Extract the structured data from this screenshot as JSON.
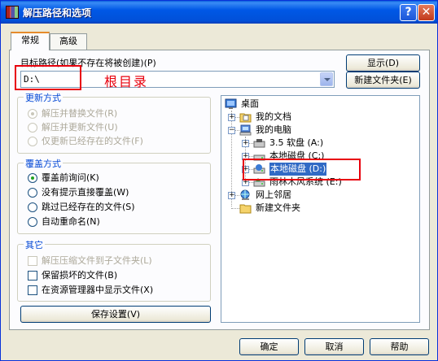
{
  "window": {
    "title": "解压路径和选项",
    "help_btn": "?",
    "close_btn": "✕"
  },
  "tabs": [
    {
      "label": "常规"
    },
    {
      "label": "高级"
    }
  ],
  "target": {
    "label": "目标路径(如果不存在将被创建)(P)",
    "value": "D:\\",
    "show_btn": "显示(D)",
    "new_folder_btn": "新建文件夹(E)"
  },
  "annotation": {
    "text": "根目录",
    "color": "#e8000c"
  },
  "update_mode": {
    "legend": "更新方式",
    "options": [
      {
        "label": "解压并替换文件(R)",
        "selected": true,
        "enabled": false
      },
      {
        "label": "解压并更新文件(U)",
        "selected": false,
        "enabled": false
      },
      {
        "label": "仅更新已经存在的文件(F)",
        "selected": false,
        "enabled": false
      }
    ]
  },
  "overwrite_mode": {
    "legend": "覆盖方式",
    "options": [
      {
        "label": "覆盖前询问(K)",
        "selected": true
      },
      {
        "label": "没有提示直接覆盖(W)",
        "selected": false
      },
      {
        "label": "跳过已经存在的文件(S)",
        "selected": false
      },
      {
        "label": "自动重命名(N)",
        "selected": false
      }
    ]
  },
  "misc": {
    "legend": "其它",
    "options": [
      {
        "label": "解压压缩文件到子文件夹(L)",
        "checked": false,
        "enabled": false
      },
      {
        "label": "保留损坏的文件(B)",
        "checked": false,
        "enabled": true
      },
      {
        "label": "在资源管理器中显示文件(X)",
        "checked": false,
        "enabled": true
      }
    ]
  },
  "save_btn": "保存设置(V)",
  "tree": [
    {
      "label": "桌面",
      "icon": "desktop-icon"
    },
    {
      "label": "我的文档",
      "icon": "documents-icon"
    },
    {
      "label": "我的电脑",
      "icon": "computer-icon"
    },
    {
      "label": "3.5 软盘 (A:)",
      "icon": "floppy-icon"
    },
    {
      "label": "本地磁盘 (C:)",
      "icon": "drive-icon"
    },
    {
      "label": "本地磁盘 (D:)",
      "icon": "drive-icon",
      "selected": true
    },
    {
      "label": "雨林木风系统 (E:)",
      "icon": "drive-icon"
    },
    {
      "label": "网上邻居",
      "icon": "network-icon"
    },
    {
      "label": "新建文件夹",
      "icon": "folder-icon"
    }
  ],
  "footer": {
    "ok": "确定",
    "cancel": "取消",
    "help": "帮助"
  }
}
